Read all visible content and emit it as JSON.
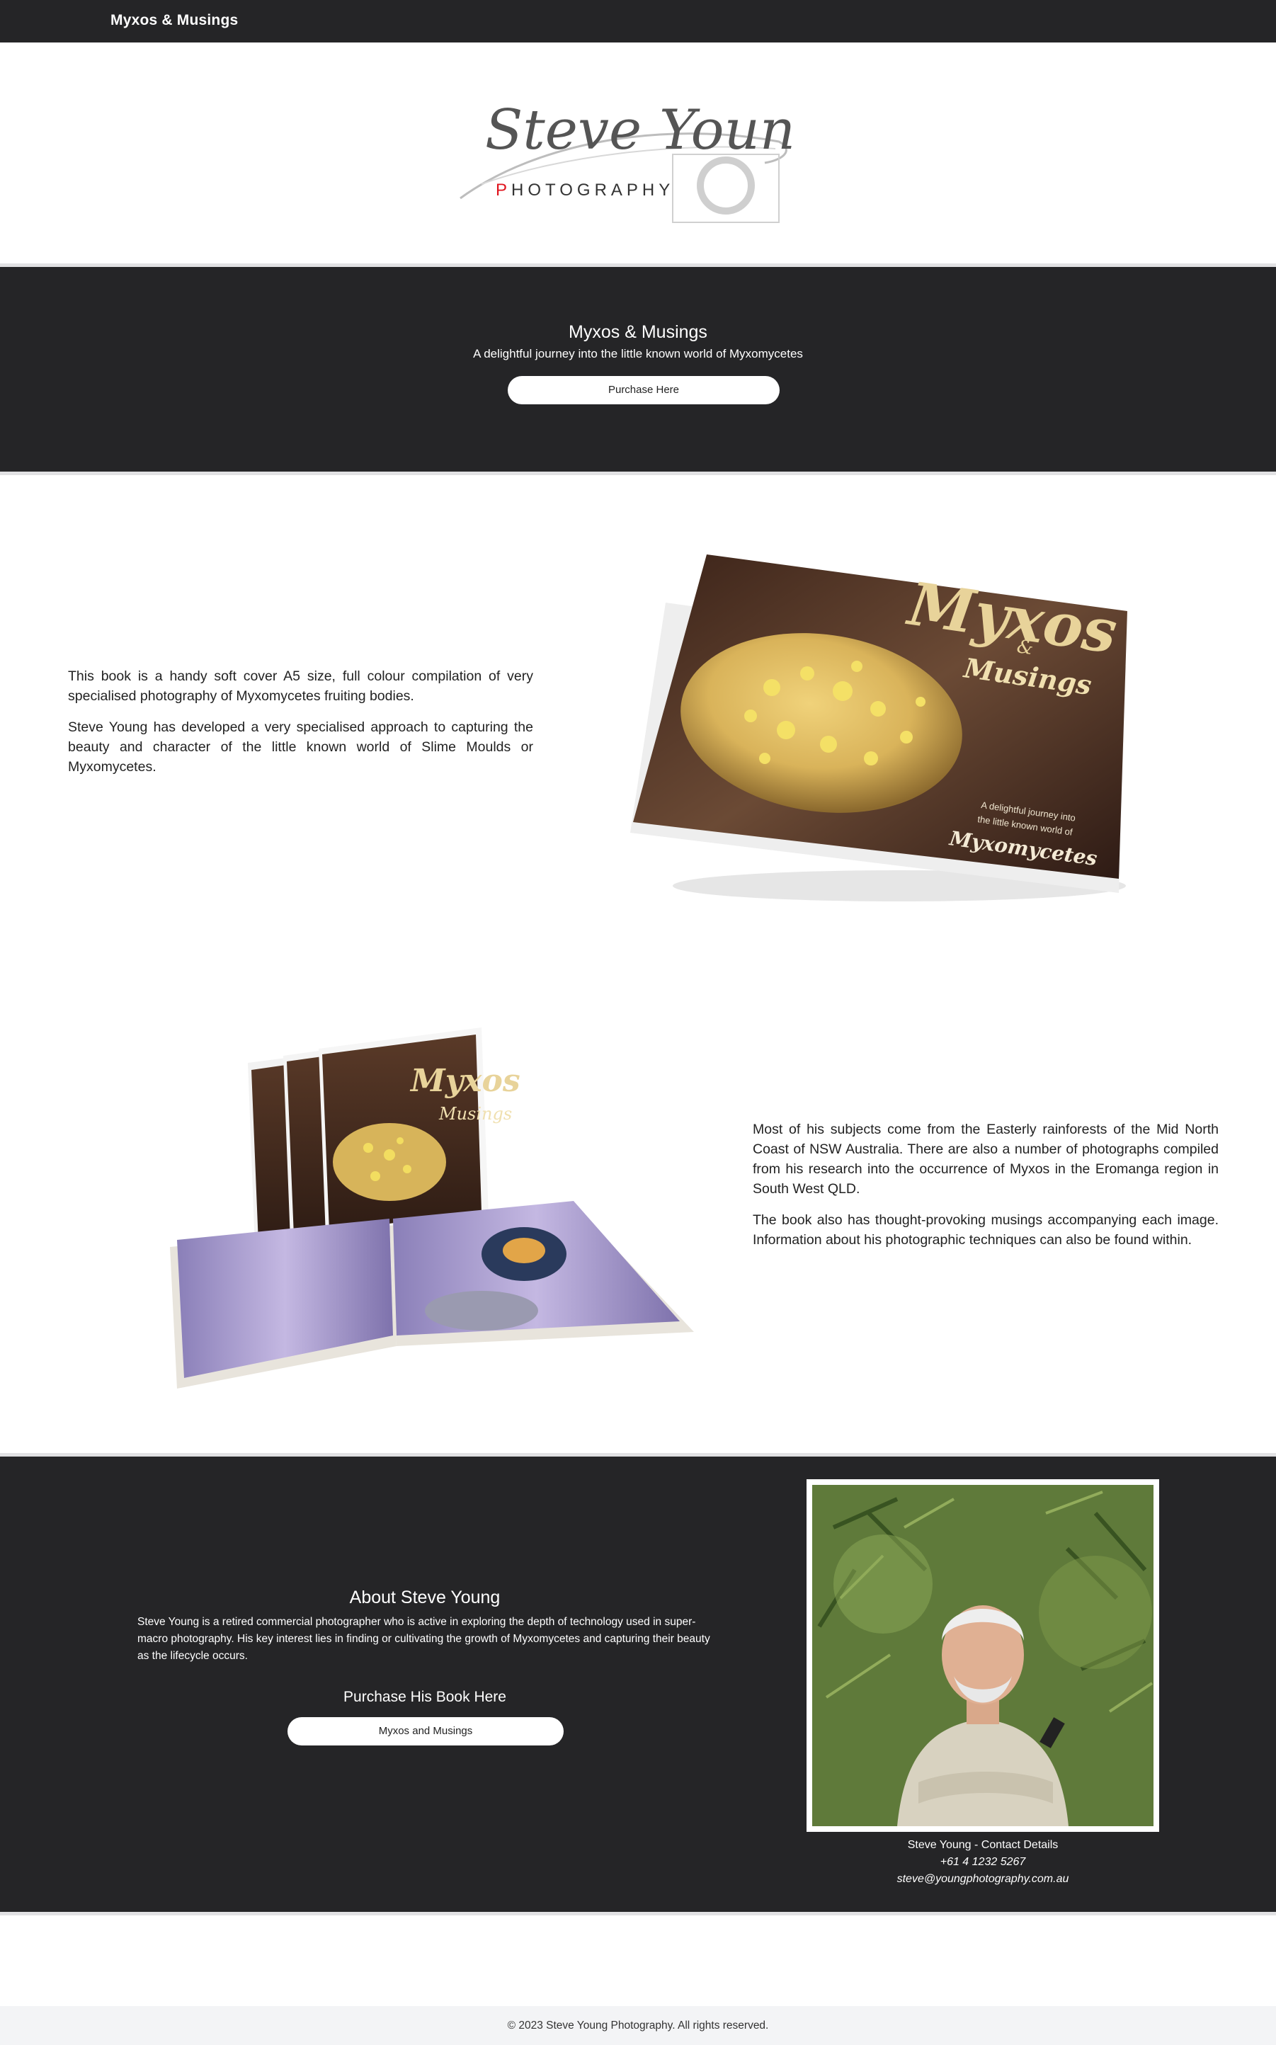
{
  "header": {
    "brand": "Myxos & Musings"
  },
  "logo": {
    "script_text": "Steve Young",
    "photography_text": "PHOTOGRAPHY",
    "accent_color": "#e0141e"
  },
  "hero": {
    "title": "Myxos & Musings",
    "subtitle": "A delightful journey into the little known world of Myxomycetes",
    "button_label": "Purchase Here"
  },
  "section1": {
    "paragraphs": [
      "This book is a handy soft cover A5 size, full colour compilation of very specialised photography of Myxomycetes fruiting bodies.",
      "Steve Young has developed a very specialised approach to capturing the beauty and character of the little known world of Slime Moulds or Myxomycetes."
    ],
    "cover": {
      "title": "Myxos",
      "amp": "&",
      "title2": "Musings",
      "tagline_line1": "A delightful journey into",
      "tagline_line2": "the little known world of",
      "subject": "Myxomycetes"
    }
  },
  "section2": {
    "paragraphs": [
      "Most of his subjects come from the Easterly rainforests of the Mid North Coast of NSW Australia. There are also a number of photographs compiled from his research into the occurrence of Myxos in the Eromanga region in South West QLD.",
      "The book also has thought-provoking musings accompanying each image. Information about his photographic techniques can also be found within."
    ]
  },
  "about": {
    "heading": "About Steve Young",
    "bio": "Steve Young is a retired commercial photographer who is active in exploring the depth of technology used in super-macro photography. His key interest lies in finding or cultivating the growth of Myxomycetes and capturing their beauty as the lifecycle occurs.",
    "purchase_heading": "Purchase His Book Here",
    "button_label": "Myxos and Musings",
    "contact_title": "Steve Young - Contact Details",
    "phone": "+61 4 1232 5267",
    "email": "steve@youngphotography.com.au"
  },
  "footer": {
    "copyright": "© 2023 Steve Young Photography. All rights reserved."
  },
  "colors": {
    "dark": "#252527",
    "divider": "#e1e1e3",
    "footer_bg": "#f3f4f6"
  }
}
